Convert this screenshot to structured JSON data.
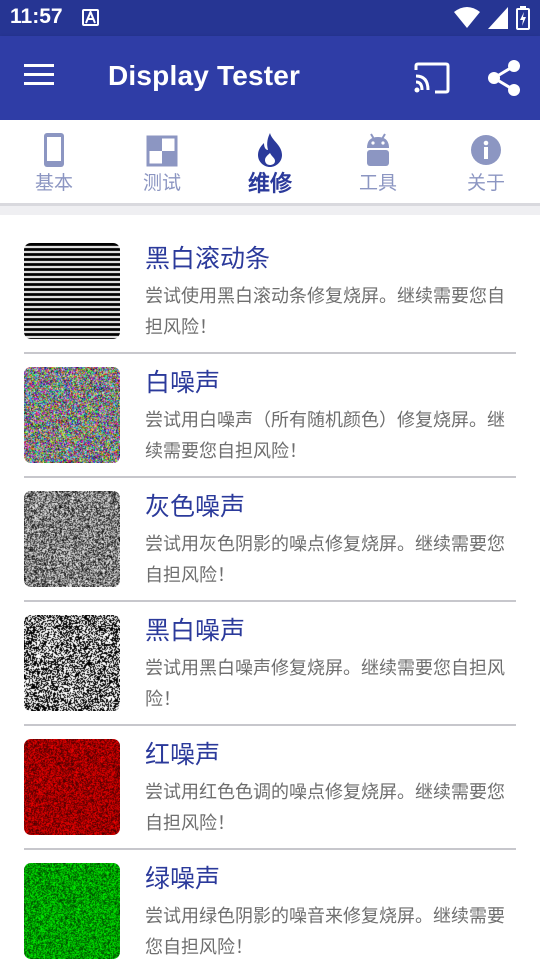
{
  "status_bar": {
    "time": "11:57",
    "notification_icon": "a-icon",
    "wifi_icon": "wifi-icon",
    "signal_icon": "signal-icon",
    "battery_icon": "battery-charging-icon"
  },
  "app_bar": {
    "title": "Display Tester",
    "menu_icon": "menu-icon",
    "cast_icon": "cast-icon",
    "share_icon": "share-icon",
    "color": "#2f3da6"
  },
  "tabs": [
    {
      "label": "基本",
      "icon": "phone-icon",
      "active": false
    },
    {
      "label": "测试",
      "icon": "checker-icon",
      "active": false
    },
    {
      "label": "维修",
      "icon": "flame-icon",
      "active": true
    },
    {
      "label": "工具",
      "icon": "android-icon",
      "active": false
    },
    {
      "label": "关于",
      "icon": "info-icon",
      "active": false
    }
  ],
  "items": [
    {
      "title": "黑白滚动条",
      "desc": "尝试使用黑白滚动条修复烧屏。继续需要您自担风险！",
      "thumb": "stripes"
    },
    {
      "title": "白噪声",
      "desc": "尝试用白噪声（所有随机颜色）修复烧屏。继续需要您自担风险！",
      "thumb": "color-noise"
    },
    {
      "title": "灰色噪声",
      "desc": "尝试用灰色阴影的噪点修复烧屏。继续需要您自担风险！",
      "thumb": "gray-noise"
    },
    {
      "title": "黑白噪声",
      "desc": "尝试用黑白噪声修复烧屏。继续需要您自担风险！",
      "thumb": "bw-noise"
    },
    {
      "title": "红噪声",
      "desc": "尝试用红色色调的噪点修复烧屏。继续需要您自担风险！",
      "thumb": "red-noise"
    },
    {
      "title": "绿噪声",
      "desc": "尝试用绿色阴影的噪音来修复烧屏。继续需要您自担风险！",
      "thumb": "green-noise"
    }
  ],
  "colors": {
    "accent": "#2b3a9b",
    "status_bar": "#263593",
    "tab_inactive": "#8c96c2"
  }
}
